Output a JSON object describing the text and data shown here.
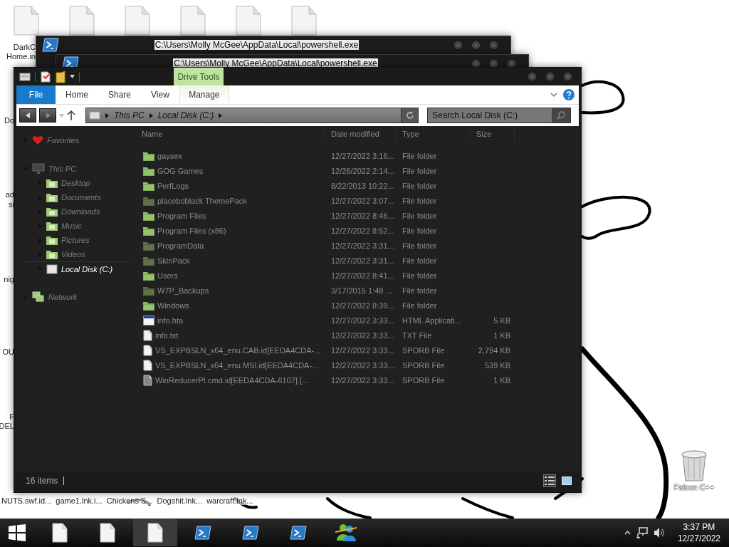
{
  "desktop": {
    "top_icons": [
      {
        "kind": "file"
      },
      {
        "kind": "file"
      },
      {
        "kind": "file"
      },
      {
        "kind": "file"
      },
      {
        "kind": "file"
      },
      {
        "kind": "file"
      }
    ],
    "first_icon_label_lines": [
      "DarkC",
      "Home.in"
    ],
    "edge_labels": [
      "Do",
      "ad",
      "si",
      "nig",
      "OU",
      "F",
      "DEL"
    ],
    "bottom_labels": [
      "NUTS.swf.id...",
      "game1.lnk.i...",
      "Chickens S...",
      "Dogshit.lnk...",
      "warcraft.lnk..."
    ],
    "recycle_bin": {
      "label": "Falcon C++"
    }
  },
  "background_windows": [
    {
      "title": "C:\\Users\\Molly McGee\\AppData\\Local\\powershell.exe"
    },
    {
      "title": "C:\\Users\\Molly McGee\\AppData\\Local\\powershell.exe"
    }
  ],
  "explorer": {
    "contextual_group": "Drive Tools",
    "ribbon_tabs": [
      {
        "label": "File",
        "kind": "file-menu",
        "contextual": false
      },
      {
        "label": "Home",
        "kind": "tab",
        "contextual": false
      },
      {
        "label": "Share",
        "kind": "tab",
        "contextual": false
      },
      {
        "label": "View",
        "kind": "tab",
        "contextual": false
      },
      {
        "label": "Manage",
        "kind": "tab",
        "contextual": true
      }
    ],
    "breadcrumbs": [
      "This PC",
      "Local Disk (C:)"
    ],
    "search": {
      "placeholder": "Search Local Disk (C:)"
    },
    "nav_tree": [
      {
        "label": "Favorites",
        "kind": "favorites",
        "expanded": false,
        "selected": false
      },
      {
        "label": "This PC",
        "kind": "computer",
        "expanded": true,
        "selected": false,
        "children": [
          {
            "label": "Desktop",
            "kind": "library",
            "expanded": false,
            "selected": false
          },
          {
            "label": "Documents",
            "kind": "library",
            "expanded": false,
            "selected": false
          },
          {
            "label": "Downloads",
            "kind": "library",
            "expanded": false,
            "selected": false
          },
          {
            "label": "Music",
            "kind": "library",
            "expanded": false,
            "selected": false
          },
          {
            "label": "Pictures",
            "kind": "library",
            "expanded": false,
            "selected": false
          },
          {
            "label": "Videos",
            "kind": "library",
            "expanded": false,
            "selected": false
          },
          {
            "label": "Local Disk (C:)",
            "kind": "drive",
            "expanded": false,
            "selected": true
          }
        ]
      },
      {
        "label": "Network",
        "kind": "network",
        "expanded": false,
        "selected": false
      }
    ],
    "columns": [
      "Name",
      "Date modified",
      "Type",
      "Size"
    ],
    "rows": [
      {
        "name": "gaysex",
        "date": "12/27/2022 3:16...",
        "type": "File folder",
        "kind": "folder"
      },
      {
        "name": "GOG Games",
        "date": "12/26/2022 2:14...",
        "type": "File folder",
        "kind": "folder"
      },
      {
        "name": "PerfLogs",
        "date": "8/22/2013 10:22...",
        "type": "File folder",
        "kind": "folder"
      },
      {
        "name": "placeboblack ThemePack",
        "date": "12/27/2022 3:07...",
        "type": "File folder",
        "kind": "hidden-folder"
      },
      {
        "name": "Program Files",
        "date": "12/27/2022 8:46...",
        "type": "File folder",
        "kind": "folder"
      },
      {
        "name": "Program Files (x86)",
        "date": "12/27/2022 8:52...",
        "type": "File folder",
        "kind": "folder"
      },
      {
        "name": "ProgramData",
        "date": "12/27/2022 3:31...",
        "type": "File folder",
        "kind": "hidden-folder"
      },
      {
        "name": "SkinPack",
        "date": "12/27/2022 3:31...",
        "type": "File folder",
        "kind": "hidden-folder"
      },
      {
        "name": "Users",
        "date": "12/27/2022 8:41...",
        "type": "File folder",
        "kind": "folder"
      },
      {
        "name": "W7P_Backups",
        "date": "3/17/2015 1:48 ...",
        "type": "File folder",
        "kind": "hidden-folder"
      },
      {
        "name": "Windows",
        "date": "12/27/2022 8:39...",
        "type": "File folder",
        "kind": "folder"
      },
      {
        "name": "info.hta",
        "date": "12/27/2022 3:33...",
        "type": "HTML Applicati...",
        "size": "5 KB",
        "kind": "application"
      },
      {
        "name": "info.txt",
        "date": "12/27/2022 3:33...",
        "type": "TXT File",
        "size": "1 KB",
        "kind": "text"
      },
      {
        "name": "VS_EXPBSLN_x64_enu.CAB.id[EEDA4CDA-...",
        "date": "12/27/2022 3:33...",
        "type": "SPORB File",
        "size": "2,794 KB",
        "kind": "file"
      },
      {
        "name": "VS_EXPBSLN_x64_enu.MSI.id[EEDA4CDA-...",
        "date": "12/27/2022 3:33...",
        "type": "SPORB File",
        "size": "539 KB",
        "kind": "file"
      },
      {
        "name": "WinReducerPI.cmd.id[EEDA4CDA-6107].[...",
        "date": "12/27/2022 3:33...",
        "type": "SPORB File",
        "size": "1 KB",
        "kind": "hidden-file"
      }
    ],
    "status": "16 items",
    "views": [
      {
        "kind": "details",
        "selected": true
      },
      {
        "kind": "large-icons",
        "selected": false
      }
    ]
  },
  "taskbar": {
    "items": [
      {
        "kind": "start",
        "selected": false
      },
      {
        "kind": "file",
        "selected": false
      },
      {
        "kind": "file",
        "selected": false
      },
      {
        "kind": "file",
        "selected": true
      },
      {
        "kind": "powershell",
        "selected": false
      },
      {
        "kind": "powershell",
        "selected": false
      },
      {
        "kind": "powershell",
        "selected": false
      },
      {
        "kind": "messenger",
        "selected": false
      }
    ],
    "time": "3:37 PM",
    "date": "12/27/2022"
  }
}
